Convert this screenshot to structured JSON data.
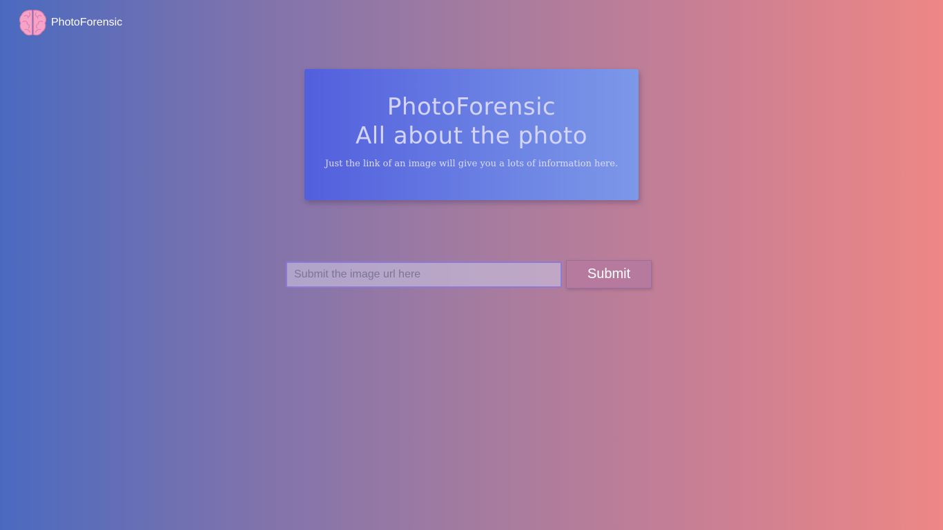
{
  "header": {
    "brand_name": "PhotoForensic",
    "logo_icon": "brain-icon"
  },
  "hero": {
    "title": "PhotoForensic",
    "subtitle": "All about the photo",
    "tagline": "Just the link of an image will give you a lots of information here."
  },
  "form": {
    "input_placeholder": "Submit the image url here",
    "input_value": "",
    "submit_label": "Submit"
  },
  "colors": {
    "background_start": "#4a6ac0",
    "background_end": "#ee8785",
    "hero_start": "#525fdd",
    "hero_end": "#7c98e8",
    "submit_button": "#b57a9e"
  }
}
